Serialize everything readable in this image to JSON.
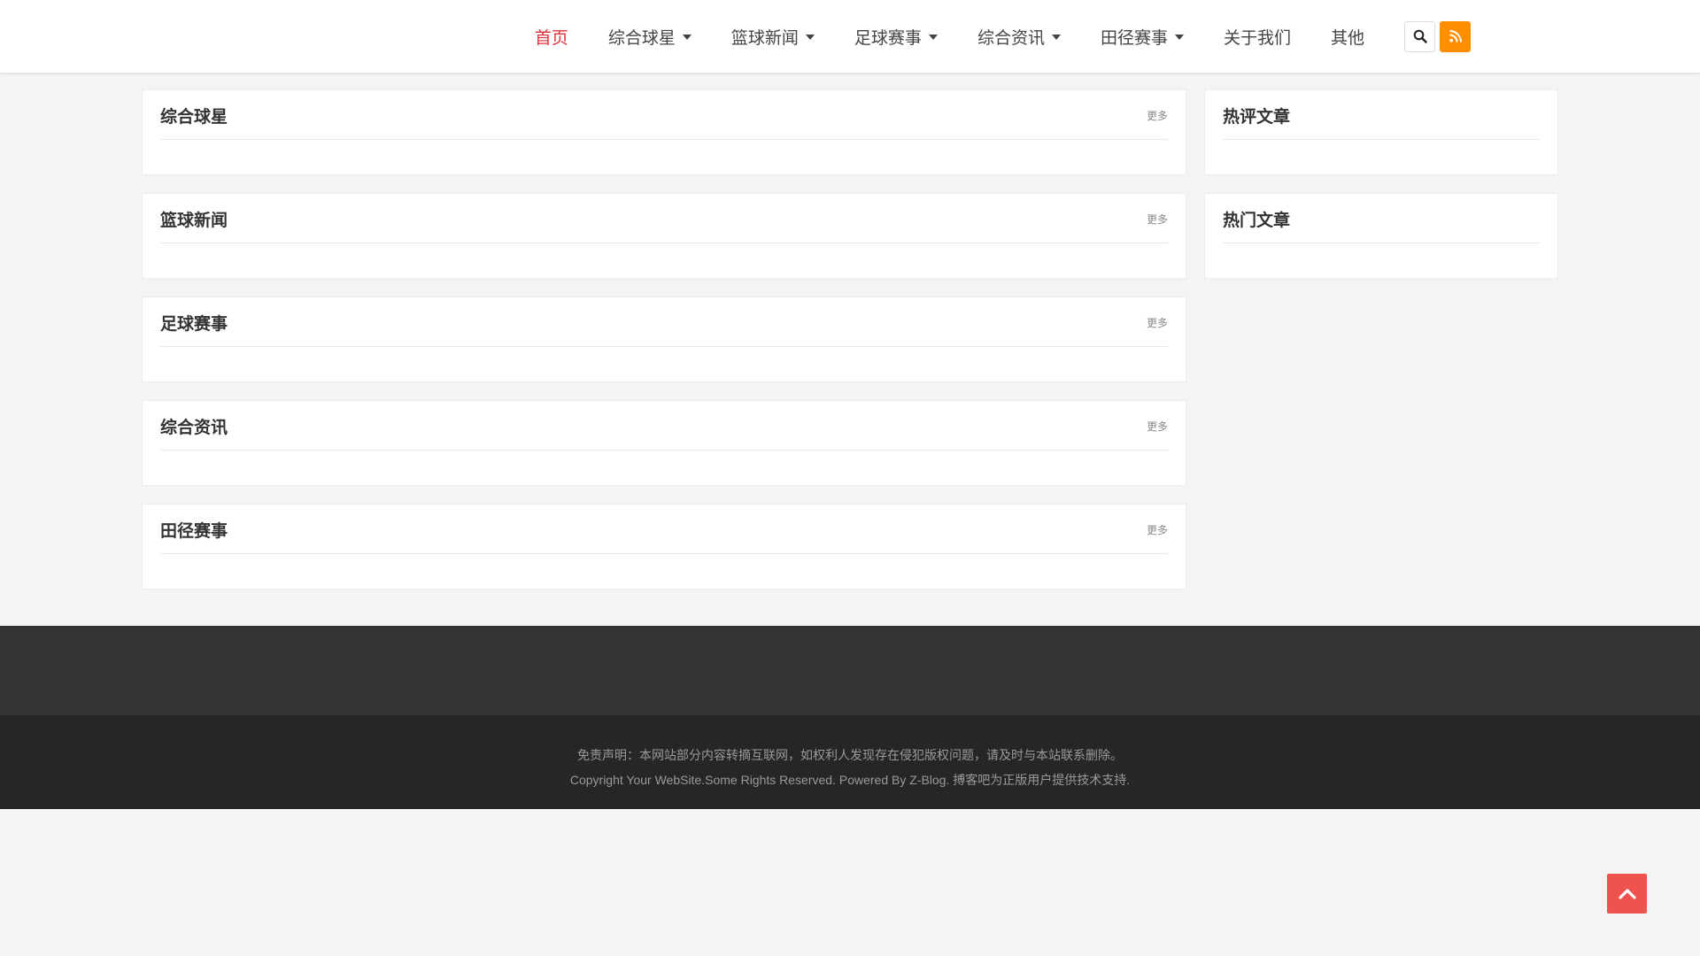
{
  "nav": {
    "items": [
      {
        "label": "首页",
        "active": true,
        "dropdown": false
      },
      {
        "label": "综合球星",
        "dropdown": true
      },
      {
        "label": "篮球新闻",
        "dropdown": true
      },
      {
        "label": "足球赛事",
        "dropdown": true
      },
      {
        "label": "综合资讯",
        "dropdown": true
      },
      {
        "label": "田径赛事",
        "dropdown": true
      },
      {
        "label": "关于我们",
        "dropdown": false
      },
      {
        "label": "其他",
        "dropdown": false
      }
    ],
    "search_icon": "search-icon",
    "rss_icon": "rss-icon"
  },
  "sections": [
    {
      "title": "综合球星",
      "more": "更多"
    },
    {
      "title": "篮球新闻",
      "more": "更多"
    },
    {
      "title": "足球赛事",
      "more": "更多"
    },
    {
      "title": "综合资讯",
      "more": "更多"
    },
    {
      "title": "田径赛事",
      "more": "更多"
    }
  ],
  "sidebar": [
    {
      "title": "热评文章"
    },
    {
      "title": "热门文章"
    }
  ],
  "footer": {
    "disclaimer": "免责声明：本网站部分内容转摘互联网，如权利人发现存在侵犯版权问题，请及时与本站联系删除。",
    "copyright": "Copyright Your WebSite.Some Rights Reserved. Powered By Z-Blog. 搏客吧为正版用户提供技术支持."
  },
  "colors": {
    "accent": "#e0303a",
    "rss": "#ff8f00",
    "back_to_top": "#f0534d",
    "footer_top": "#333333",
    "footer_bottom": "#262626"
  }
}
